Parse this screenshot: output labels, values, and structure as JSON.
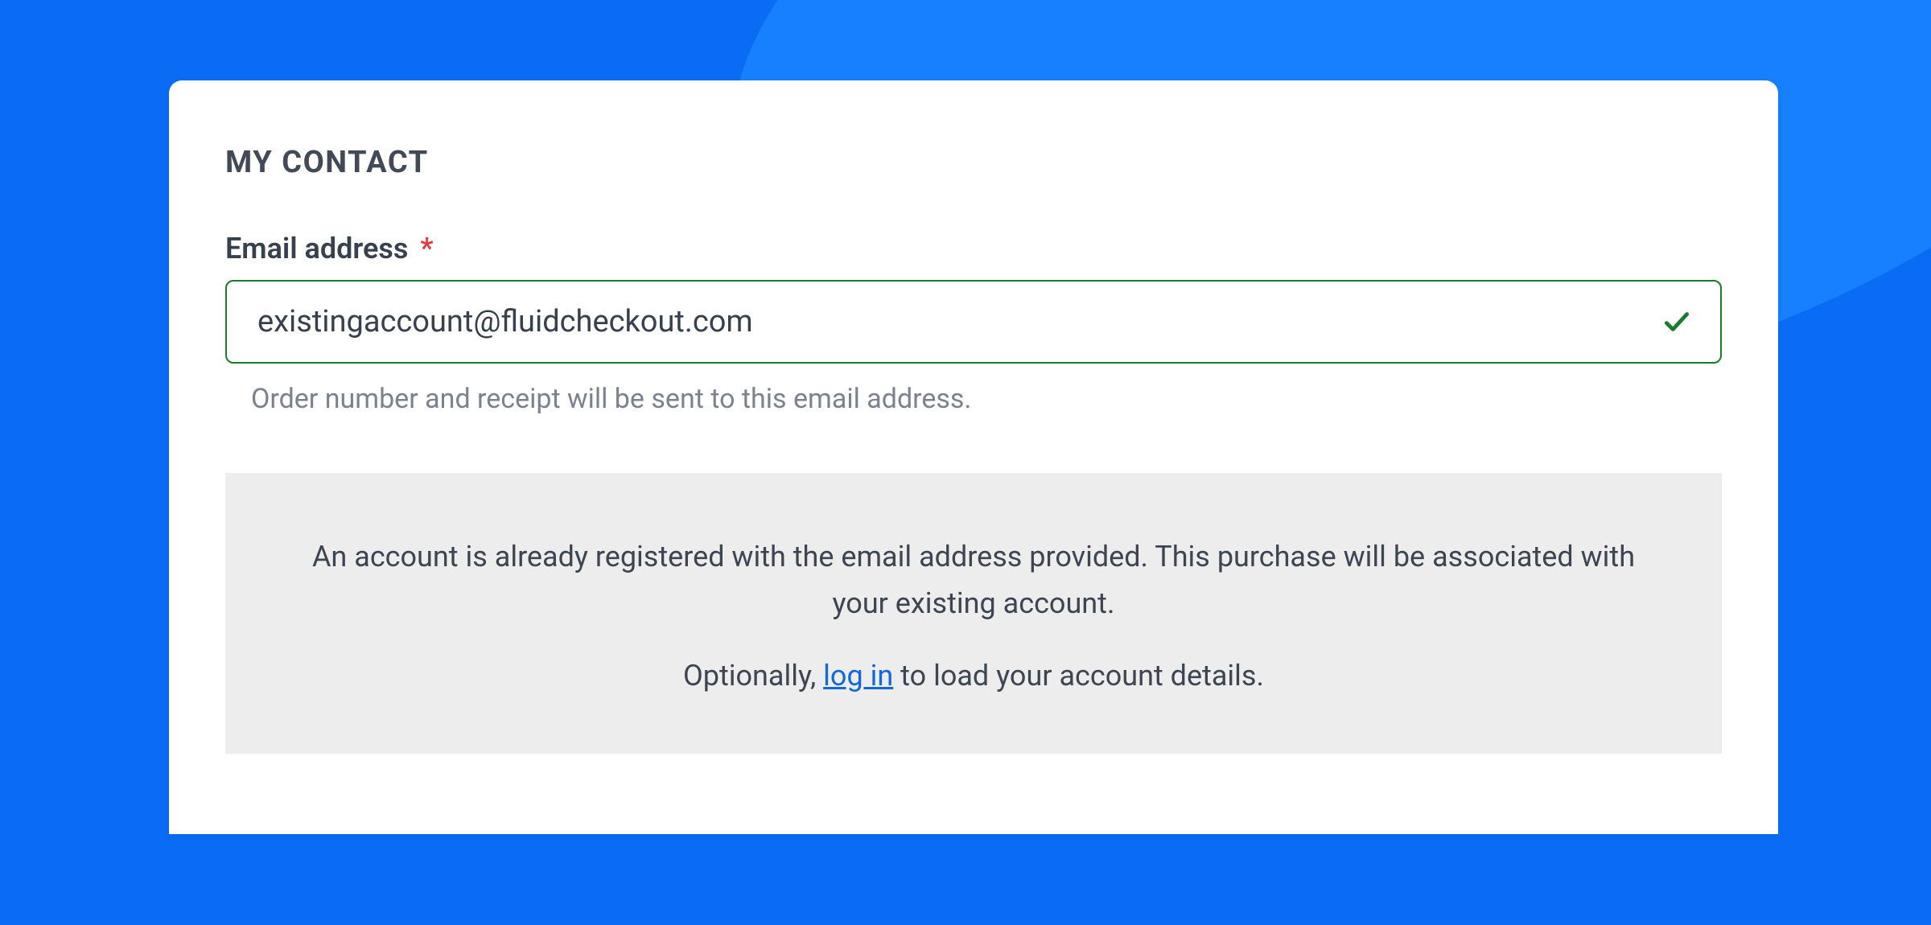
{
  "section": {
    "title": "MY CONTACT"
  },
  "email_field": {
    "label": "Email address",
    "required_marker": "*",
    "value": "existingaccount@fluidcheckout.com",
    "helper": "Order number and receipt will be sent to this email address."
  },
  "notice": {
    "message": "An account is already registered with the email address provided. This purchase will be associated with your existing account.",
    "optional_prefix": "Optionally, ",
    "login_link": "log in",
    "optional_suffix": " to load your account details."
  }
}
